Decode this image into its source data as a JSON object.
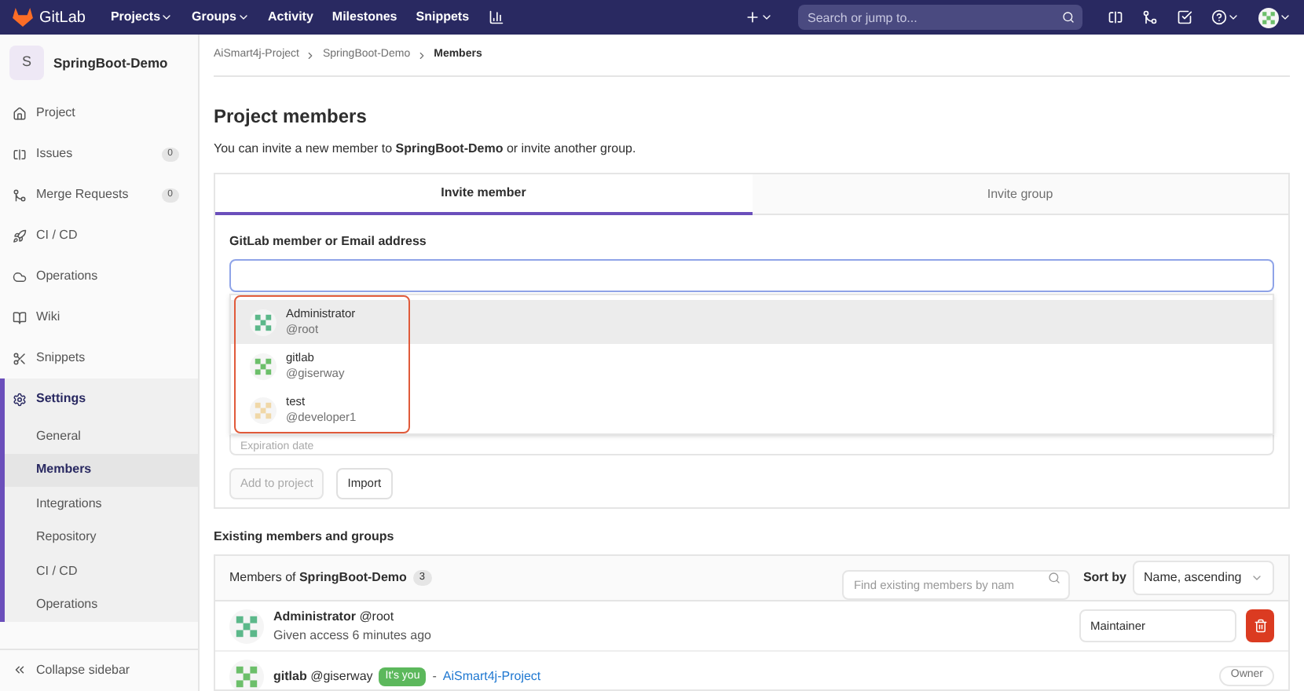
{
  "topbar": {
    "logo_text": "GitLab",
    "nav": [
      {
        "label": "Projects",
        "dropdown": true
      },
      {
        "label": "Groups",
        "dropdown": true
      },
      {
        "label": "Activity",
        "dropdown": false
      },
      {
        "label": "Milestones",
        "dropdown": false
      },
      {
        "label": "Snippets",
        "dropdown": false
      }
    ],
    "search": {
      "placeholder": "Search or jump to..."
    }
  },
  "sidebar": {
    "project": {
      "initial": "S",
      "name": "SpringBoot-Demo"
    },
    "items": [
      {
        "kind": "home",
        "label": "Project",
        "selected": false
      },
      {
        "kind": "issues",
        "label": "Issues",
        "count": "0",
        "selected": false
      },
      {
        "kind": "merge",
        "label": "Merge Requests",
        "count": "0",
        "selected": false
      },
      {
        "kind": "rocket",
        "label": "CI / CD",
        "selected": false
      },
      {
        "kind": "cloud",
        "label": "Operations",
        "selected": false
      },
      {
        "kind": "book",
        "label": "Wiki",
        "selected": false
      },
      {
        "kind": "scissors",
        "label": "Snippets",
        "selected": false
      },
      {
        "kind": "gear",
        "label": "Settings",
        "selected": true,
        "children": [
          {
            "label": "General",
            "selected": false
          },
          {
            "label": "Members",
            "selected": true
          },
          {
            "label": "Integrations",
            "selected": false
          },
          {
            "label": "Repository",
            "selected": false
          },
          {
            "label": "CI / CD",
            "selected": false
          },
          {
            "label": "Operations",
            "selected": false
          }
        ]
      }
    ],
    "collapse": "Collapse sidebar"
  },
  "breadcrumbs": [
    {
      "label": "AiSmart4j-Project",
      "current": false
    },
    {
      "label": "SpringBoot-Demo",
      "current": false
    },
    {
      "label": "Members",
      "current": true
    }
  ],
  "title": "Project members",
  "intro": "You can invite a new member to **SpringBoot-Demo** or invite another group.",
  "tabs": [
    {
      "label": "Invite member",
      "selected": true
    },
    {
      "label": "Invite group",
      "selected": false
    }
  ],
  "field_label": "GitLab member or Email address",
  "suggestions": [
    {
      "name": "Administrator",
      "username": "@root",
      "color": "#5cb88a",
      "selected": true
    },
    {
      "name": "gitlab",
      "username": "@giserway",
      "color": "#6cbf6a",
      "selected": false
    },
    {
      "name": "test",
      "username": "@developer1",
      "color": "#f0d8a8",
      "selected": false
    }
  ],
  "expiration": {
    "placeholder": "Expiration date"
  },
  "buttons": [
    {
      "label": "Add to project",
      "disabled": true
    },
    {
      "label": "Import",
      "disabled": false
    }
  ],
  "existing": {
    "heading": "Existing members and groups",
    "panel_title": "Members of **SpringBoot-Demo**",
    "count": "3",
    "search": {
      "placeholder": "Find existing members by nam"
    },
    "sort_label": "Sort by",
    "sort_value": "Name, ascending",
    "members": [
      {
        "kind": "editable",
        "name": "Administrator",
        "username": "@root",
        "color": "#5cb88a",
        "access": "Given access 6 minutes ago",
        "role": "Maintainer"
      },
      {
        "kind": "owner",
        "name": "gitlab",
        "username": "@giserway",
        "color": "#6cbf6a",
        "you_badge": "It's you",
        "separator": "-",
        "source": "AiSmart4j-Project",
        "role": "Owner"
      }
    ]
  }
}
